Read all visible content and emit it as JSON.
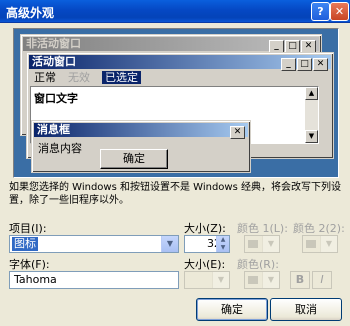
{
  "dialog": {
    "title": "高级外观",
    "help_btn": "?",
    "close_btn": "✕"
  },
  "preview": {
    "inactive_title": "非活动窗口",
    "active_title": "活动窗口",
    "menu": {
      "normal": "正常",
      "disabled": "无效",
      "selected": "已选定"
    },
    "window_text": "窗口文字",
    "message_box": {
      "title": "消息框",
      "text": "消息内容",
      "ok": "确定"
    },
    "caption_buttons": {
      "min": "_",
      "max": "□",
      "close": "✕"
    }
  },
  "description": "如果您选择的 Windows 和按钮设置不是 Windows 经典，将会改写下列设置，除了一些旧程序以外。",
  "item": {
    "label": "项目(I):",
    "value": "图标"
  },
  "size": {
    "label": "大小(Z):",
    "value": "32"
  },
  "color1": {
    "label": "颜色 1(L):"
  },
  "color2": {
    "label": "颜色 2(2):"
  },
  "font": {
    "label": "字体(F):",
    "value": "Tahoma"
  },
  "font_size": {
    "label": "大小(E):"
  },
  "font_color": {
    "label": "颜色(R):"
  },
  "bold_btn": "B",
  "italic_btn": "I",
  "buttons": {
    "ok": "确定",
    "cancel": "取消"
  },
  "icons": {
    "dropdown": "chevron-down-icon"
  }
}
